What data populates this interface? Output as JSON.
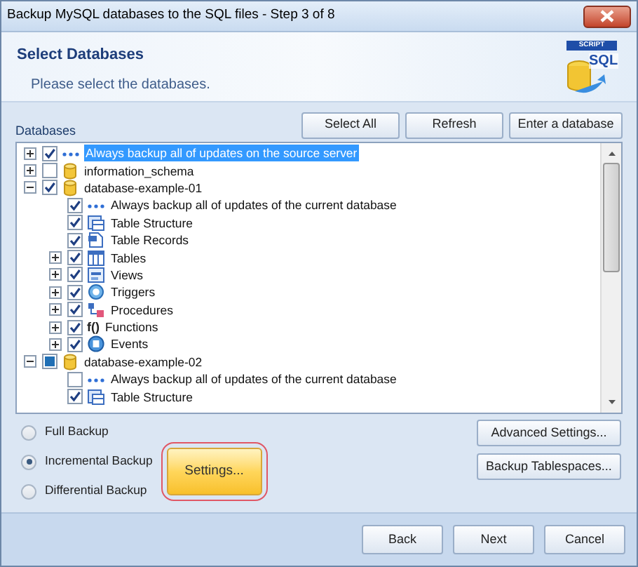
{
  "window": {
    "title": "Backup MySQL databases to the SQL files - Step 3 of 8"
  },
  "header": {
    "title": "Select Databases",
    "subtitle": "Please select the databases.",
    "logo_badge": "SCRIPT",
    "logo_text": "SQL"
  },
  "databases_label": "Databases",
  "toolbar_buttons": [
    "Select All",
    "Refresh",
    "Enter a database"
  ],
  "tree": [
    {
      "label": "Always backup all of updates on the source server",
      "kind": "dots",
      "expanded": false,
      "checked": true,
      "selected": true
    },
    {
      "label": "information_schema",
      "kind": "database",
      "expanded": false,
      "checked": false,
      "selected": false
    },
    {
      "label": "database-example-01",
      "kind": "database",
      "expanded": true,
      "checked": true,
      "selected": false,
      "children": [
        {
          "label": "Always backup all of updates of the current database",
          "kind": "dots",
          "checked": true,
          "selected": false
        },
        {
          "label": "Table Structure",
          "kind": "structure",
          "checked": true,
          "selected": false
        },
        {
          "label": "Table Records",
          "kind": "records",
          "checked": true,
          "selected": false
        },
        {
          "label": "Tables",
          "kind": "tables",
          "expanded": false,
          "checked": true,
          "selected": false
        },
        {
          "label": "Views",
          "kind": "views",
          "expanded": false,
          "checked": true,
          "selected": false
        },
        {
          "label": "Triggers",
          "kind": "triggers",
          "expanded": false,
          "checked": true,
          "selected": false
        },
        {
          "label": "Procedures",
          "kind": "procedures",
          "expanded": false,
          "checked": true,
          "selected": false
        },
        {
          "label": "Functions",
          "kind": "glyph",
          "glyph": "f()",
          "expanded": false,
          "checked": true,
          "selected": false
        },
        {
          "label": "Events",
          "kind": "events",
          "expanded": false,
          "checked": true,
          "selected": false
        }
      ]
    },
    {
      "label": "database-example-02",
      "kind": "database",
      "expanded": true,
      "checked": false,
      "partial": true,
      "selected": false,
      "children": [
        {
          "label": "Always backup all of updates of the current database",
          "kind": "dots",
          "checked": false,
          "selected": false
        },
        {
          "label": "Table Structure",
          "kind": "structure",
          "checked": true,
          "selected": false
        }
      ]
    }
  ],
  "backup_types": [
    {
      "label": "Full Backup",
      "selected": false
    },
    {
      "label": "Incremental Backup",
      "selected": true
    },
    {
      "label": "Differential Backup",
      "selected": false
    }
  ],
  "settings_button": {
    "label": "Settings...",
    "highlighted": true
  },
  "side_buttons": [
    "Advanced Settings...",
    "Backup Tablespaces..."
  ],
  "footer_buttons": [
    "Back",
    "Next",
    "Cancel"
  ]
}
